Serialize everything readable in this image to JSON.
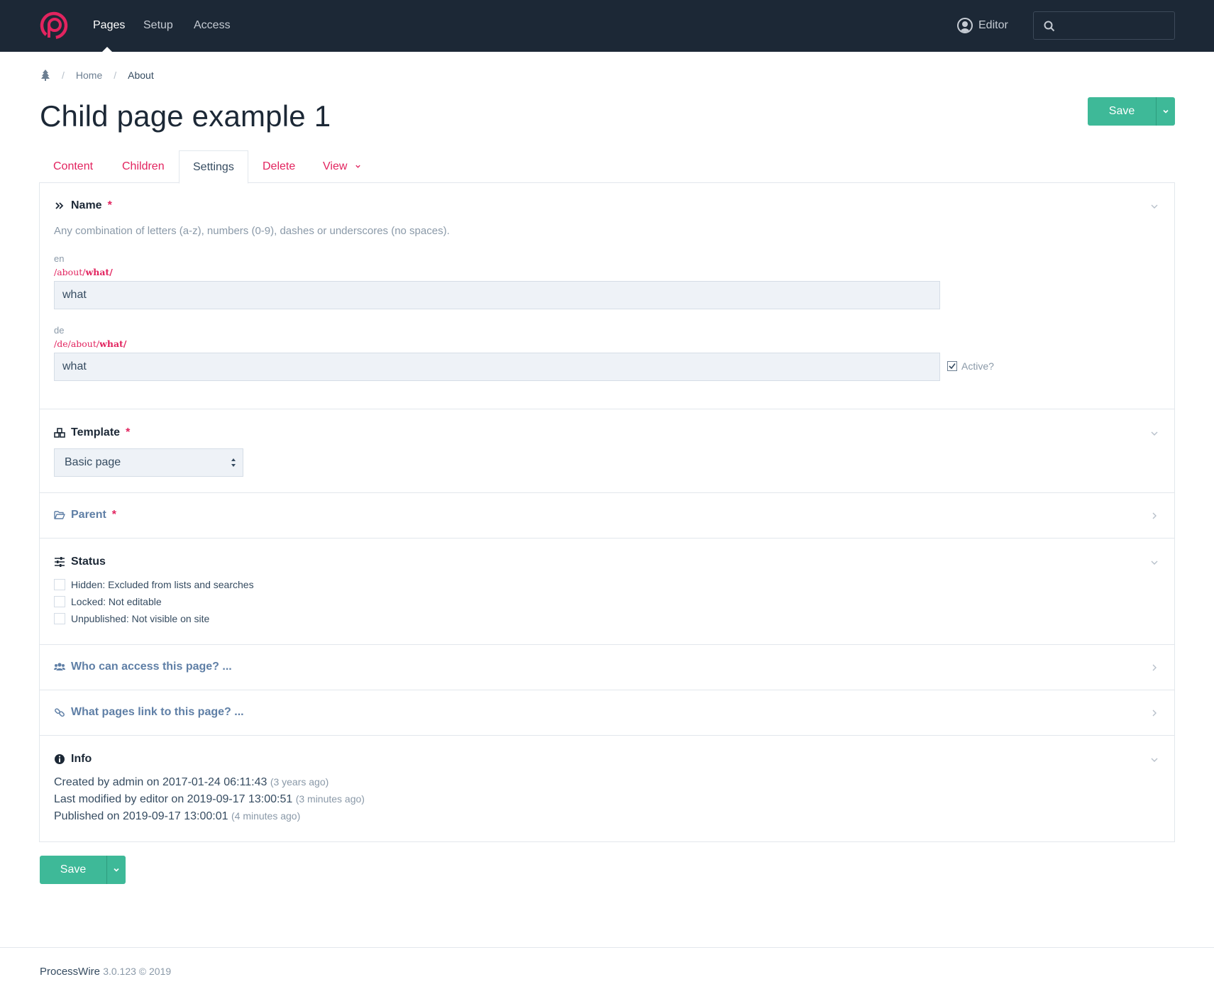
{
  "nav": {
    "items": [
      "Pages",
      "Setup",
      "Access"
    ],
    "user": "Editor",
    "search_placeholder": ""
  },
  "breadcrumb": {
    "home": "Home",
    "current": "About",
    "separator": "/"
  },
  "page": {
    "title": "Child page example 1"
  },
  "save": {
    "label": "Save"
  },
  "tabs": [
    {
      "label": "Content"
    },
    {
      "label": "Children"
    },
    {
      "label": "Settings"
    },
    {
      "label": "Delete"
    },
    {
      "label": "View"
    }
  ],
  "name_section": {
    "title": "Name",
    "required": "*",
    "help": "Any combination of letters (a-z), numbers (0-9), dashes or underscores (no spaces).",
    "en": {
      "lang": "en",
      "url_prefix": "/about/",
      "url_name": "what/",
      "value": "what"
    },
    "de": {
      "lang": "de",
      "url_prefix": "/de/about/",
      "url_name": "what/",
      "value": "what",
      "active_label": "Active?"
    }
  },
  "template_section": {
    "title": "Template",
    "required": "*",
    "selected": "Basic page"
  },
  "parent_section": {
    "title": "Parent",
    "required": "*"
  },
  "status_section": {
    "title": "Status",
    "options": [
      "Hidden: Excluded from lists and searches",
      "Locked: Not editable",
      "Unpublished: Not visible on site"
    ]
  },
  "access_section": {
    "title": "Who can access this page? ..."
  },
  "links_section": {
    "title": "What pages link to this page? ..."
  },
  "info_section": {
    "title": "Info",
    "lines": [
      {
        "text": "Created by admin on 2017-01-24 06:11:43",
        "ago": "(3 years ago)"
      },
      {
        "text": "Last modified by editor on 2019-09-17 13:00:51",
        "ago": "(3 minutes ago)"
      },
      {
        "text": "Published on 2019-09-17 13:00:01",
        "ago": "(4 minutes ago)"
      }
    ]
  },
  "footer": {
    "brand": "ProcessWire",
    "meta": "3.0.123 © 2019"
  },
  "colors": {
    "nav_bg": "#1c2836",
    "accent": "#e2245f",
    "save": "#3eb998"
  }
}
